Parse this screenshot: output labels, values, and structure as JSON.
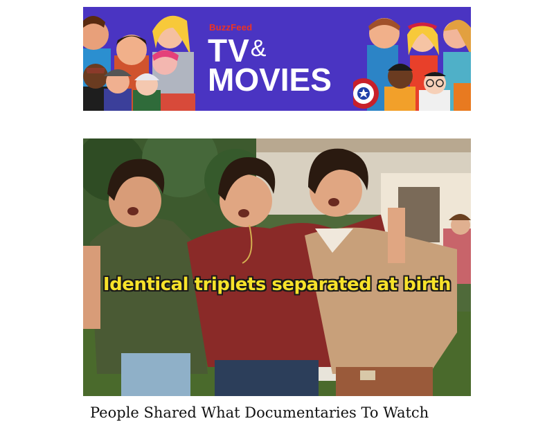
{
  "banner": {
    "brand": "BuzzFeed",
    "title_line1": "TV",
    "title_amp": "&",
    "title_line2": "MOVIES",
    "colors": {
      "background": "#4a34c2",
      "brand_red": "#ee3322",
      "text": "#ffffff"
    }
  },
  "article": {
    "image_caption": "Identical triplets separated at birth",
    "headline": "People Shared What Documentaries To Watch"
  }
}
